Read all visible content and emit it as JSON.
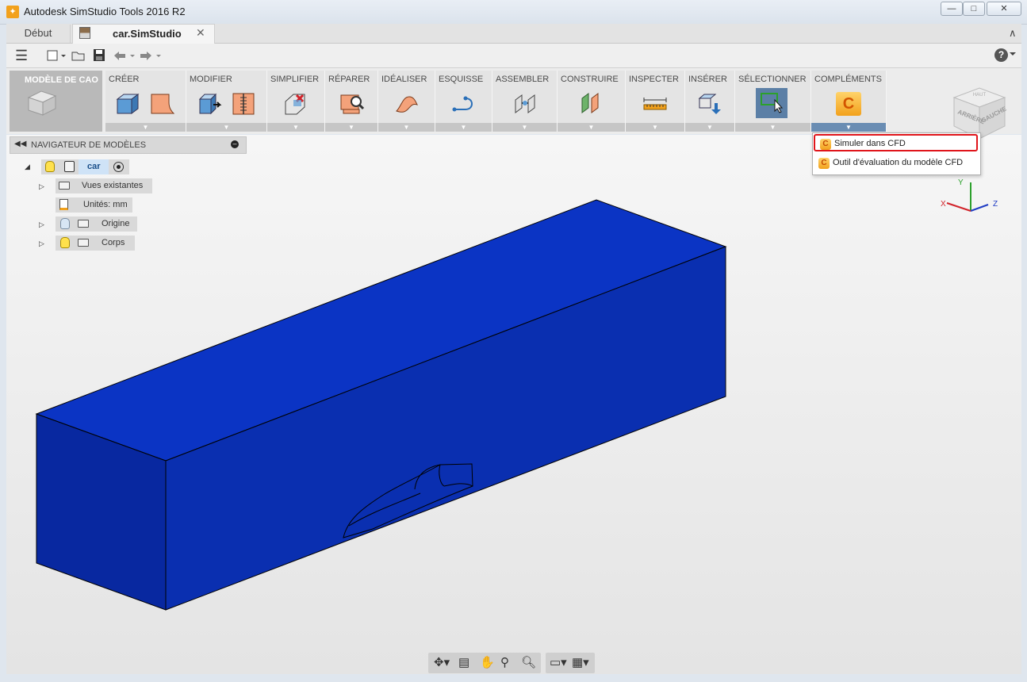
{
  "window": {
    "title": "Autodesk SimStudio Tools 2016 R2",
    "controls": {
      "minimize": "—",
      "maximize": "□",
      "close": "✕"
    }
  },
  "tabs": {
    "home_label": "Début",
    "active_label": "car.SimStudio",
    "close_glyph": "✕",
    "collapse_glyph": "∧"
  },
  "quick_access": {
    "menu_glyph": "☰",
    "help_glyph": "?"
  },
  "ribbon": {
    "workspace_label": "MODÈLE DE CAO",
    "groups": [
      {
        "label": "CRÉER"
      },
      {
        "label": "MODIFIER"
      },
      {
        "label": "SIMPLIFIER"
      },
      {
        "label": "RÉPARER"
      },
      {
        "label": "IDÉALISER"
      },
      {
        "label": "ESQUISSE"
      },
      {
        "label": "ASSEMBLER"
      },
      {
        "label": "CONSTRUIRE"
      },
      {
        "label": "INSPECTER"
      },
      {
        "label": "INSÉRER"
      },
      {
        "label": "SÉLECTIONNER"
      },
      {
        "label": "COMPLÉMENTS"
      }
    ],
    "arrow_glyph": "▼"
  },
  "complements_menu": {
    "items": [
      {
        "label": "Simuler dans CFD",
        "highlighted": true
      },
      {
        "label": "Outil d'évaluation du modèle CFD",
        "highlighted": false
      }
    ],
    "icon_letter": "C"
  },
  "nav_cube": {
    "face_back": "ARRIÈRE",
    "face_left": "GAUCHE",
    "face_top": "HAUT"
  },
  "axes": {
    "x": "X",
    "y": "Y",
    "z": "Z"
  },
  "browser": {
    "title": "NAVIGATEUR DE MODÈLES",
    "root": {
      "label": "car"
    },
    "children": [
      {
        "label": "Vues existantes"
      },
      {
        "label": "Unités: mm"
      },
      {
        "label": "Origine"
      },
      {
        "label": "Corps"
      }
    ]
  },
  "colors": {
    "model_blue": "#0a2fb0",
    "model_top": "#0b34c4",
    "model_side": "#0828a0",
    "highlight_red": "#e0151b",
    "accent_orange": "#f2a11c"
  }
}
